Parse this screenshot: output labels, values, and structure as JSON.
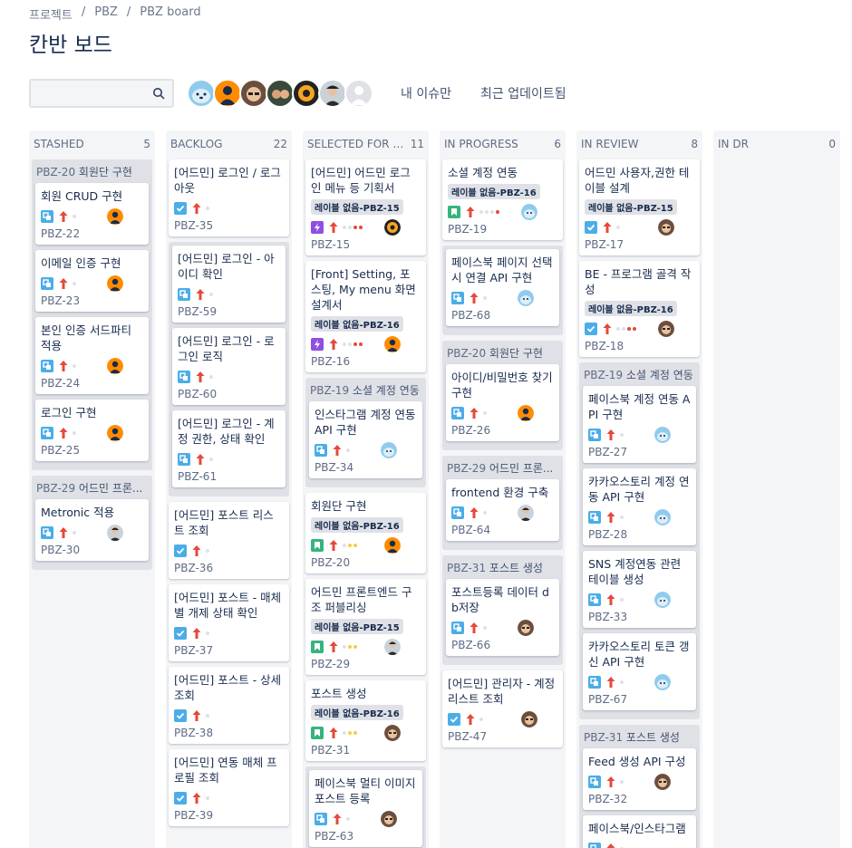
{
  "breadcrumb": [
    "프로젝트",
    "PBZ",
    "PBZ board"
  ],
  "title": "칸반 보드",
  "search": {
    "value": "",
    "placeholder": ""
  },
  "quick_filters": [
    "내 이슈만",
    "최근 업데이트됨"
  ],
  "colors": {
    "story": "#36b37e",
    "subtask": "#4bade8",
    "task": "#4bade8",
    "epic": "#904ee2",
    "priority_high": "#e5493a"
  },
  "columns": [
    {
      "name": "STASHED",
      "count": "5"
    },
    {
      "name": "BACKLOG",
      "count": "22"
    },
    {
      "name": "SELECTED FOR DEV...",
      "count": "11"
    },
    {
      "name": "IN PROGRESS",
      "count": "6"
    },
    {
      "name": "IN REVIEW",
      "count": "8"
    },
    {
      "name": "IN DR",
      "count": "0"
    }
  ],
  "stashed": {
    "swim1": {
      "key": "PBZ-20",
      "name": "회원단 구현"
    },
    "cards1": [
      {
        "summary": "회원 CRUD 구현",
        "key": "PBZ-22"
      },
      {
        "summary": "이메일 인증 구현",
        "key": "PBZ-23"
      },
      {
        "summary": "본인 인증 서드파티 적용",
        "key": "PBZ-24"
      },
      {
        "summary": "로그인 구현",
        "key": "PBZ-25"
      }
    ],
    "swim2": {
      "key": "PBZ-29",
      "name": "어드민 프론..."
    },
    "cards2": [
      {
        "summary": "Metronic 적용",
        "key": "PBZ-30"
      }
    ]
  },
  "backlog": {
    "cards1": [
      {
        "summary": "[어드민] 로그인 / 로그아웃",
        "key": "PBZ-35"
      }
    ],
    "subcards": [
      {
        "summary": "[어드민] 로그인 - 아이디 확인",
        "key": "PBZ-59"
      },
      {
        "summary": "[어드민] 로그인 - 로그인 로직",
        "key": "PBZ-60"
      },
      {
        "summary": "[어드민] 로그인 - 계정 권한, 상태 확인",
        "key": "PBZ-61"
      }
    ],
    "cards2": [
      {
        "summary": "[어드민] 포스트 리스트 조회",
        "key": "PBZ-36"
      },
      {
        "summary": "[어드민] 포스트 - 매체별 개제 상태 확인",
        "key": "PBZ-37"
      },
      {
        "summary": "[어드민] 포스트 - 상세 조회",
        "key": "PBZ-38"
      },
      {
        "summary": "[어드민] 연동 매체 프로필 조회",
        "key": "PBZ-39"
      }
    ]
  },
  "selected": {
    "cards1": [
      {
        "summary": "[어드민] 어드민 로그인 메뉴 등 기획서",
        "label": "레이블 없음-PBZ-15",
        "key": "PBZ-15"
      },
      {
        "summary": "[Front] Setting, 포스팅, My menu 화면 설계서",
        "label": "레이블 없음-PBZ-16",
        "key": "PBZ-16"
      }
    ],
    "swim1": {
      "key": "PBZ-19",
      "name": "소셜 계정 연동"
    },
    "swimcards1": [
      {
        "summary": "인스타그램 계정 연동 API 구현",
        "key": "PBZ-34"
      }
    ],
    "cards2": [
      {
        "summary": "회원단 구현",
        "label": "레이블 없음-PBZ-16",
        "key": "PBZ-20"
      },
      {
        "summary": "어드민 프론트엔드 구조 퍼블리싱",
        "label": "레이블 없음-PBZ-15",
        "key": "PBZ-29"
      },
      {
        "summary": "포스트 생성",
        "label": "레이블 없음-PBZ-16",
        "key": "PBZ-31"
      }
    ],
    "subcards": [
      {
        "summary": "페이스북 멀티 이미지 포스트 등록",
        "key": "PBZ-63"
      }
    ]
  },
  "progress": {
    "cards1": [
      {
        "summary": "소셜 계정 연동",
        "label": "레이블 없음-PBZ-16",
        "key": "PBZ-19"
      }
    ],
    "subcards": [
      {
        "summary": "페이스북 페이지 선택시 연결 API 구현",
        "key": "PBZ-68"
      }
    ],
    "swim1": {
      "key": "PBZ-20",
      "name": "회원단 구현"
    },
    "swimcards1": [
      {
        "summary": "아이디/비밀번호 찾기 구현",
        "key": "PBZ-26"
      }
    ],
    "swim2": {
      "key": "PBZ-29",
      "name": "어드민 프론..."
    },
    "swimcards2": [
      {
        "summary": "frontend 환경 구축",
        "key": "PBZ-64"
      }
    ],
    "swim3": {
      "key": "PBZ-31",
      "name": "포스트 생성"
    },
    "swimcards3": [
      {
        "summary": "포스트등록 데이터 db저장",
        "key": "PBZ-66"
      }
    ],
    "cards2": [
      {
        "summary": "[어드민] 관리자 - 계정 리스트 조회",
        "key": "PBZ-47"
      }
    ]
  },
  "review": {
    "cards1": [
      {
        "summary": "어드민 사용자,권한 테이블 설계",
        "label": "레이블 없음-PBZ-15",
        "key": "PBZ-17"
      },
      {
        "summary": "BE - 프로그램 골격 작성",
        "label": "레이블 없음-PBZ-16",
        "key": "PBZ-18"
      }
    ],
    "swim1": {
      "key": "PBZ-19",
      "name": "소셜 계정 연동"
    },
    "swimcards1": [
      {
        "summary": "페이스북 계정 연동 API 구현",
        "key": "PBZ-27"
      },
      {
        "summary": "카카오스토리 계정 연동 API 구현",
        "key": "PBZ-28"
      },
      {
        "summary": "SNS 계정연동 관련 테이블 생성",
        "key": "PBZ-33"
      },
      {
        "summary": "카카오스토리 토큰 갱신 API 구현",
        "key": "PBZ-67"
      }
    ],
    "swim2": {
      "key": "PBZ-31",
      "name": "포스트 생성"
    },
    "swimcards2": [
      {
        "summary": "Feed 생성 API 구성",
        "key": "PBZ-32"
      },
      {
        "summary": "페이스북/인스타그램",
        "key": ""
      }
    ]
  }
}
